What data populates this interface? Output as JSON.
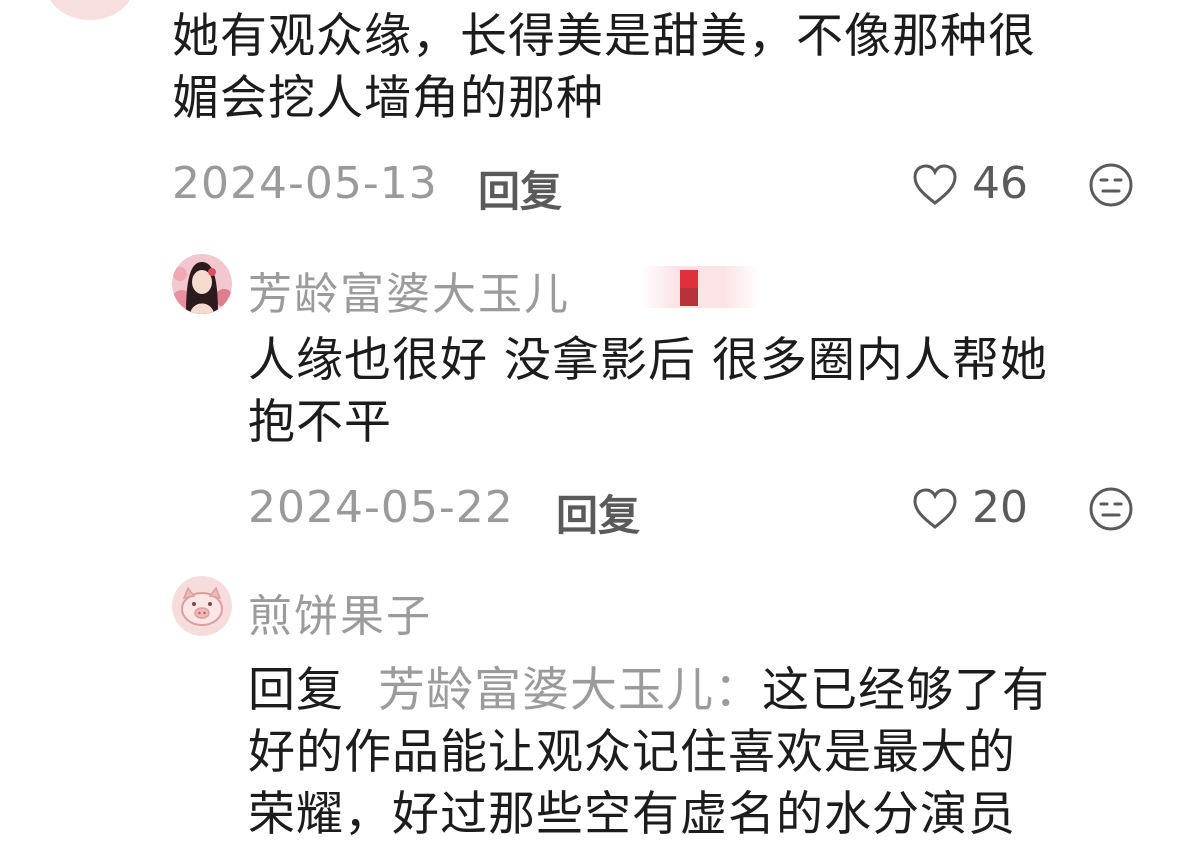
{
  "comment1": {
    "text_line1": "她有观众缘，长得美是甜美，不像那种很",
    "text_line2": "媚会挖人墙角的那种",
    "date": "2024-05-13",
    "reply_label": "回复",
    "likes": "46"
  },
  "comment2": {
    "username": "芳龄富婆大玉儿",
    "text_line1": "人缘也很好 没拿影后 很多圈内人帮她",
    "text_line2": "抱不平",
    "date": "2024-05-22",
    "reply_label": "回复",
    "likes": "20"
  },
  "comment3": {
    "username": "煎饼果子",
    "reply_prefix": "回复",
    "reply_target": "芳龄富婆大玉儿：",
    "text_line1_rest": "这已经够了有",
    "text_line2": "好的作品能让观众记住喜欢是最大的",
    "text_line3": "荣耀，好过那些空有虚名的水分演员"
  },
  "icons": {
    "like": "heart-outline-icon",
    "more": "neutral-face-icon",
    "avatar2": "woman-portrait-avatar",
    "avatar3": "pig-face-avatar"
  },
  "colors": {
    "text": "#1c1c1c",
    "meta": "#9a9a9a",
    "username": "#9b9b9b",
    "avatar_bg": "#f7dfe0"
  }
}
